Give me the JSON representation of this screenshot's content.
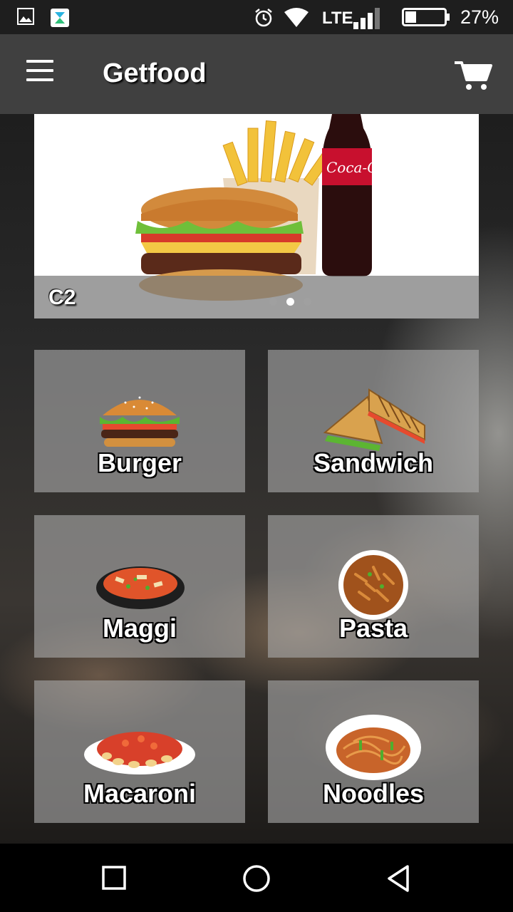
{
  "status_bar": {
    "battery_percent": "27%",
    "network": "LTE",
    "icons": [
      "gallery-icon",
      "app-notification-icon",
      "alarm-icon",
      "wifi-icon",
      "signal-icon",
      "battery-icon"
    ]
  },
  "app_bar": {
    "title": "Getfood",
    "menu_icon": "hamburger-menu-icon",
    "cart_icon": "shopping-cart-icon"
  },
  "banner": {
    "label": "C2",
    "slide_count": 3,
    "active_slide": 2
  },
  "categories": [
    {
      "label": "Burger",
      "icon": "burger-icon"
    },
    {
      "label": "Sandwich",
      "icon": "sandwich-icon"
    },
    {
      "label": "Maggi",
      "icon": "maggi-icon"
    },
    {
      "label": "Pasta",
      "icon": "pasta-icon"
    },
    {
      "label": "Macaroni",
      "icon": "macaroni-icon"
    },
    {
      "label": "Noodles",
      "icon": "noodles-icon"
    }
  ],
  "nav_bar": {
    "icons": [
      "recent-apps-icon",
      "home-icon",
      "back-icon"
    ]
  },
  "colors": {
    "app_bar": "#404040",
    "status_bar": "#1e1e1e",
    "tile": "#aaaaaa",
    "nav_bar": "#000000"
  }
}
